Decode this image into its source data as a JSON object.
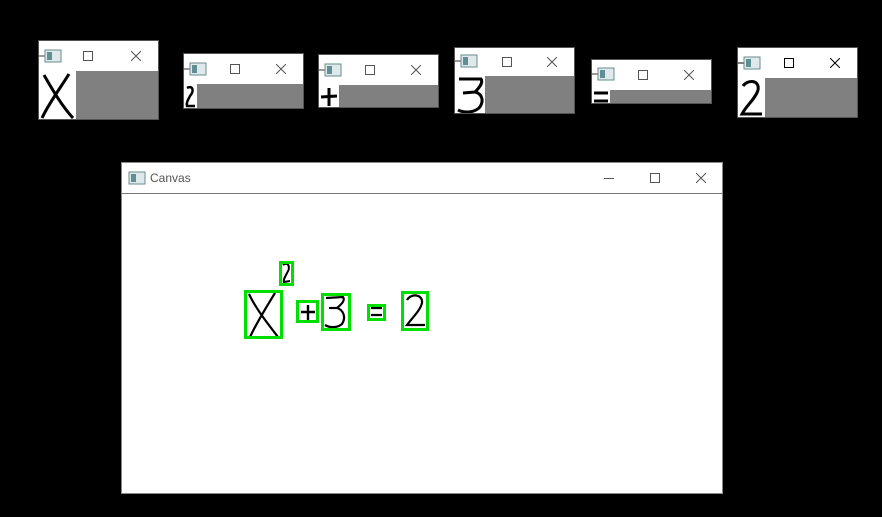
{
  "canvas_window": {
    "title": "Canvas"
  },
  "symbol_windows": [
    {
      "symbol": "X"
    },
    {
      "symbol": "2"
    },
    {
      "symbol": "+"
    },
    {
      "symbol": "3"
    },
    {
      "symbol": "="
    },
    {
      "symbol": "2"
    }
  ],
  "colors": {
    "desktop": "#000000",
    "bounding_box": "#00e000",
    "empty_area": "#808080"
  },
  "icons": [
    "app-icon",
    "minimize-icon",
    "maximize-icon",
    "close-icon"
  ]
}
